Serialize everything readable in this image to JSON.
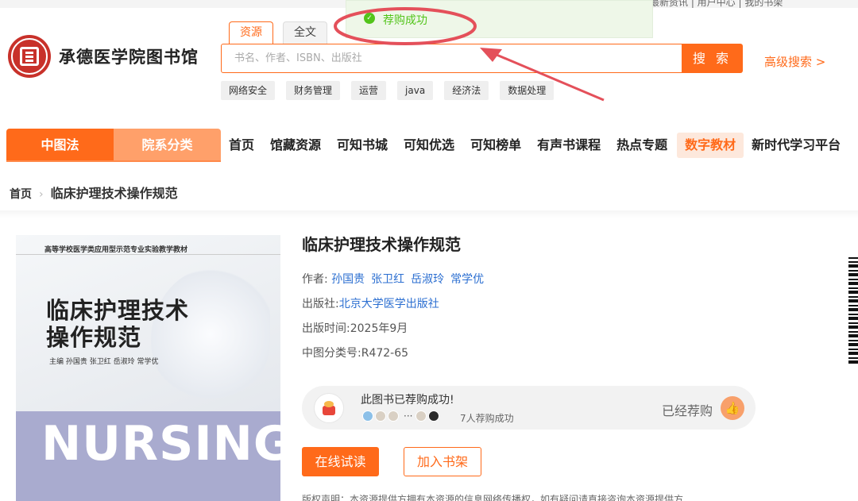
{
  "top_strip": {
    "text": "最新资讯  |  用户中心  |  我的书架"
  },
  "logo": {
    "name": "承德医学院图书馆"
  },
  "search": {
    "tabs": [
      "资源",
      "全文"
    ],
    "placeholder": "书名、作者、ISBN、出版社",
    "button": "搜 索",
    "advanced": "高级搜索 >",
    "hot_tags": [
      "网络安全",
      "财务管理",
      "运营",
      "java",
      "经济法",
      "数据处理"
    ]
  },
  "toast": {
    "message": "荐购成功"
  },
  "nav": {
    "segments": [
      "中图法",
      "院系分类"
    ],
    "items": [
      "首页",
      "馆藏资源",
      "可知书城",
      "可知优选",
      "可知榜单",
      "有声书课程",
      "热点专题",
      "数字教材",
      "新时代学习平台"
    ],
    "highlighted": "数字教材"
  },
  "breadcrumb": {
    "home": "首页",
    "current": "临床护理技术操作规范"
  },
  "cover": {
    "series": "高等学校医学类应用型示范专业实验教学教材",
    "title_line1": "临床护理技术",
    "title_line2": "操作规范",
    "editors": "主编   孙国贵   张卫红   岳淑玲   常学优",
    "band_text": "NURSING"
  },
  "book": {
    "title": "临床护理技术操作规范",
    "author_label": "作者:",
    "authors": [
      "孙国贵",
      "张卫红",
      "岳淑玲",
      "常学优"
    ],
    "publisher_label": "出版社:",
    "publisher": "北京大学医学出版社",
    "pubdate_label": "出版时间:",
    "pubdate": "2025年9月",
    "clc_label": "中图分类号:",
    "clc": "R472-65"
  },
  "recommend": {
    "status": "此图书已荐购成功!",
    "dots": "···",
    "count_text": "7人荐购成功",
    "done": "已经荐购"
  },
  "actions": {
    "read": "在线试读",
    "shelf": "加入书架"
  },
  "copyright": "版权声明：本资源提供方拥有本资源的信息网络传播权，如有疑问请直接咨询本资源提供方",
  "colors": {
    "accent": "#ff6a1a",
    "link": "#2c6fd1",
    "success": "#52c41a",
    "annotation": "#e4505a"
  }
}
